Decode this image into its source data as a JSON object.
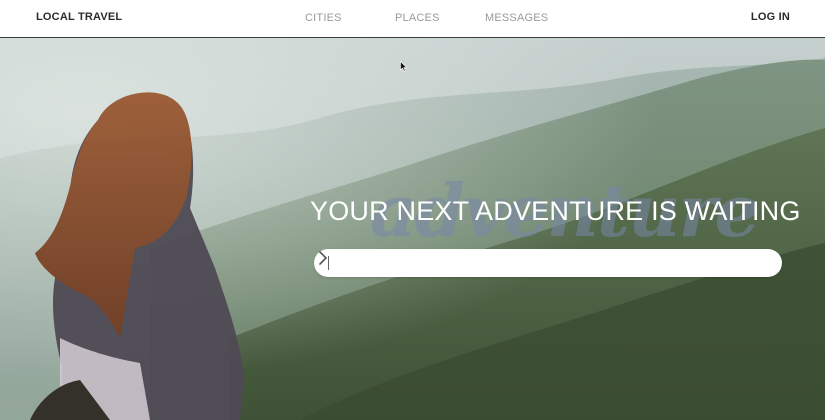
{
  "nav": {
    "brand": "LOCAL TRAVEL",
    "items": [
      {
        "label": "CITIES"
      },
      {
        "label": "PLACES"
      },
      {
        "label": "MESSAGES"
      }
    ],
    "login": "LOG IN"
  },
  "hero": {
    "script_word": "adventure",
    "headline": "YOUR NEXT ADVENTURE IS WAITING",
    "search": {
      "value": "",
      "placeholder": "",
      "go_icon": "chevron-right-icon"
    },
    "background": "mountain-landscape-photo"
  },
  "colors": {
    "nav_text_dark": "#2b2b2b",
    "nav_text_muted": "#9a9a9a",
    "headline": "#ffffff",
    "script_word": "#7887aa"
  }
}
